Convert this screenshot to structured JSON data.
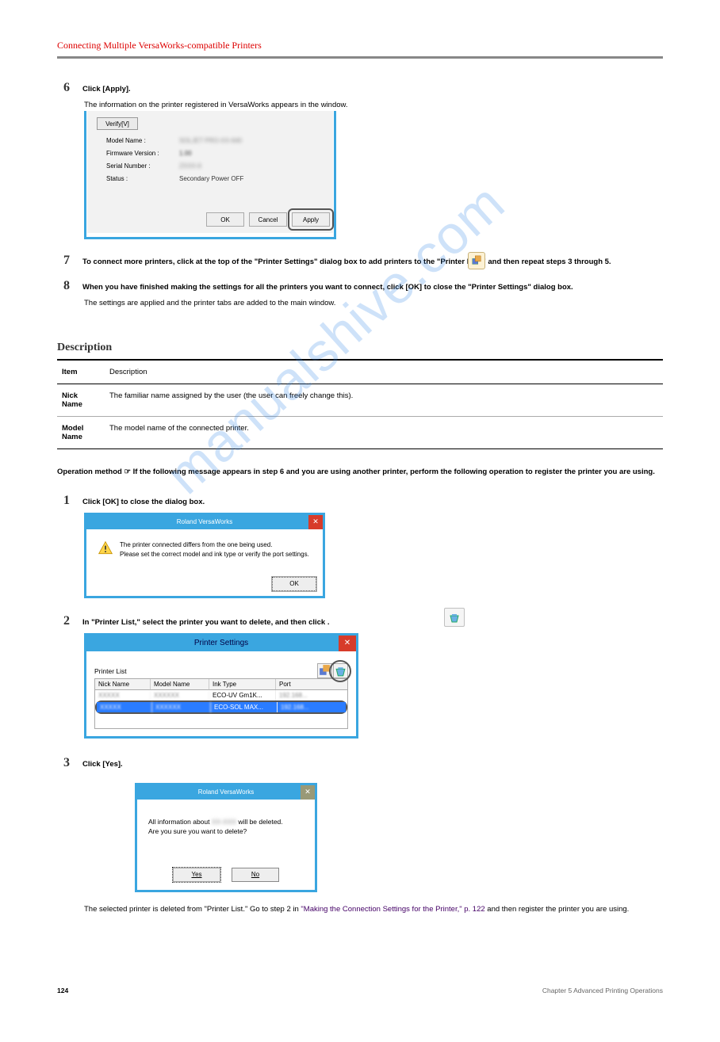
{
  "section_title": "Connecting Multiple VersaWorks-compatible Printers",
  "step6": {
    "num": "6",
    "text": "Click [Apply]."
  },
  "step6_body": "The information on the printer registered in VersaWorks appears in the window.",
  "dlg1": {
    "verify": "Verify[V]",
    "model_lbl": "Model Name :",
    "model_val": "SOLJET PRO-XX-640",
    "fw_lbl": "Firmware Version :",
    "fw_val": "1.00",
    "serial_lbl": "Serial Number :",
    "serial_val": "ZXXX-6",
    "status_lbl": "Status :",
    "status_val": "Secondary Power OFF",
    "ok": "OK",
    "cancel": "Cancel",
    "apply": "Apply"
  },
  "step7": {
    "num": "7",
    "text": "To connect more printers, click       at the top of the \"Printer Settings\" dialog box to add printers to the \"Printer List,\" and then repeat steps 3 through 5."
  },
  "step8": {
    "num": "8",
    "text": "When you have finished making the settings for all the printers you want to connect, click [OK] to close the \"Printer Settings\" dialog box."
  },
  "step8_body": "The settings are applied and the printer tabs are added to the main window.",
  "sub_h": "Description",
  "tbl": {
    "item_h": "Item",
    "desc_h": "Description",
    "r1_item": "Nick Name",
    "r1_desc": "The familiar name assigned by the user (the user can freely change this).",
    "r2_item": "Model  Name",
    "r2_desc": "The model name of the connected printer."
  },
  "op_intro": "Operation method   ☞   If the following message appears in step 6 and you are using another printer, perform the following operation to register the printer you are using.",
  "op1": {
    "num": "1",
    "text": "Click [OK] to close the dialog box."
  },
  "dlg2": {
    "title": "Roland VersaWorks",
    "line1": "The printer connected differs from the one being used.",
    "line2": "Please set the correct model and ink type or verify the port settings.",
    "ok": "OK"
  },
  "op2": {
    "num": "2",
    "text": "In \"Printer List,\" select the printer you want to delete, and then click        ."
  },
  "dlg3": {
    "title": "Printer Settings",
    "pl": "Printer List",
    "h1": "Nick Name",
    "h2": "Model Name",
    "h3": "Ink Type",
    "h4": "Port",
    "r1c1": "XXXXX",
    "r1c2": "XXXXXX",
    "r1c3": "ECO-UV Gm1K...",
    "r1c4": "192.168...",
    "r2c1": "XXXXX",
    "r2c2": "XXXXXX",
    "r2c3": "ECO-SOL MAX...",
    "r2c4": "192.168..."
  },
  "op3": {
    "num": "3",
    "text": "Click [Yes]."
  },
  "dlg4": {
    "title": "Roland VersaWorks",
    "line1_a": "All information about ",
    "line1_b": " will be deleted.",
    "line2": "Are you sure you want to delete?",
    "yes": "Yes",
    "no": "No",
    "blur": "XX-XXX"
  },
  "end_note_a": "The selected printer is deleted from \"Printer List.\" Go to step 2 in ",
  "end_note_link": "\"Making the Connection Settings for the Printer,\" p. 122",
  "end_note_b": " and then register the printer you are using.",
  "footer_pg": "124",
  "footer_ch": "Chapter 5   Advanced Printing Operations",
  "watermark": "manualshive.com"
}
